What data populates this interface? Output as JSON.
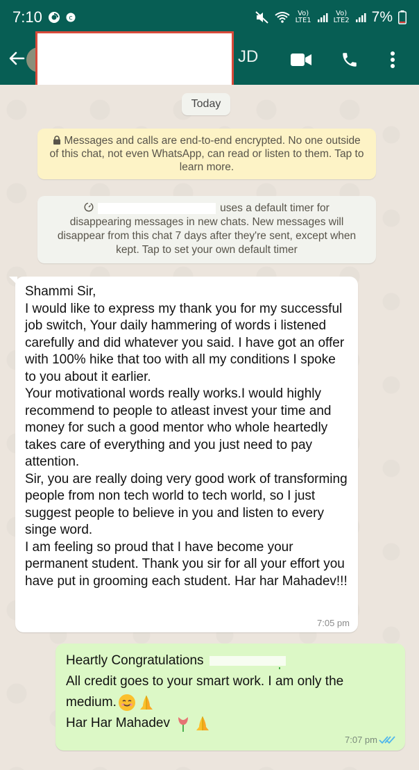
{
  "status_bar": {
    "time": "7:10",
    "net_top_1": "Vo)",
    "net_bottom_1": "LTE1",
    "net_top_2": "Vo)",
    "net_bottom_2": "LTE2",
    "battery": "7%"
  },
  "header": {
    "contact_initials": "JD"
  },
  "chat": {
    "date_chip": "Today",
    "encryption_notice": "Messages and calls are end-to-end encrypted. No one outside of this chat, not even WhatsApp, can read or listen to them. Tap to learn more.",
    "timer_notice_suffix": "uses a default timer for",
    "timer_notice_rest": "disappearing messages in new chats. New messages will disappear from this chat 7 days after they're sent, except when kept. Tap to set your own default timer",
    "incoming": {
      "text": "Shammi Sir,\nI would like to express my thank you for my successful job switch, Your daily hammering of words i listened carefully and did whatever you said. I have got an offer with 100% hike that too with all my conditions I spoke to you about it earlier.\nYour motivational words really works.I would highly recommend to people to atleast invest your time and money for such a good mentor who whole heartedly takes care of everything and you just need to pay attention.\nSir, you are really doing very good work of transforming people from non tech world to tech world, so I just suggest people to believe in you and listen to every singe word.\nI am feeling so proud that I have become your permanent student. Thank you sir for all your effort you have put in grooming each student. Har har Mahadev!!!",
      "time": "7:05 pm"
    },
    "outgoing": {
      "line1": "Heartly Congratulations",
      "line2": "All credit goes to your smart work. I am only the",
      "line3": "medium.",
      "line4": "Har Har Mahadev",
      "time": "7:07 pm"
    }
  },
  "colors": {
    "header": "#075e54",
    "chat_bg": "#ece5dd",
    "outgoing_bubble": "#dcf8c6",
    "read_ticks": "#4fb6ec"
  }
}
